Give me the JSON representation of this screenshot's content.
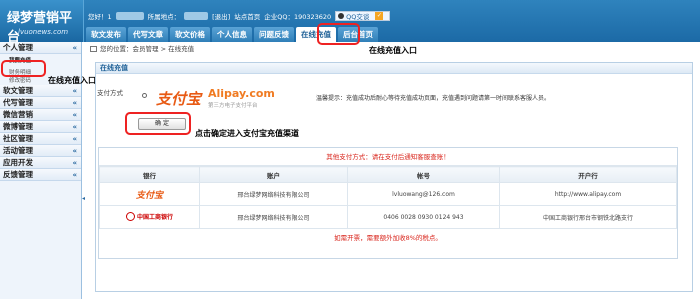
{
  "logo": {
    "title": "绿梦营销平台",
    "domain": "lvuonews.com"
  },
  "topbar": {
    "greeting": "您好！1",
    "region_label": "所属地点：",
    "logout": "[退出]",
    "site_home": "站点首页",
    "company_qq": "企业QQ：190323620",
    "qq_chat": "QQ交谈"
  },
  "nav": {
    "tabs": [
      "软文发布",
      "代写文章",
      "软文价格",
      "个人信息",
      "问题反馈",
      "在线充值",
      "后台首页"
    ],
    "active": 5
  },
  "sidebar": {
    "groups": [
      {
        "label": "个人管理",
        "subs": [
          "我要充值",
          "财务明细",
          "修改密码"
        ]
      },
      {
        "label": "软文管理",
        "subs": []
      },
      {
        "label": "代写管理",
        "subs": []
      },
      {
        "label": "微信营销",
        "subs": []
      },
      {
        "label": "微博管理",
        "subs": []
      },
      {
        "label": "社区管理",
        "subs": []
      },
      {
        "label": "活动管理",
        "subs": []
      },
      {
        "label": "应用开发",
        "subs": []
      },
      {
        "label": "反馈管理",
        "subs": []
      }
    ]
  },
  "breadcrumb": "您的位置：会员管理 > 在线充值",
  "panel": {
    "title": "在线充值",
    "pay_method_label": "支付方式",
    "alipay_cn": "支付宝",
    "alipay_en": "Alipay.com",
    "alipay_sub": "第三方电子支付平台",
    "tip": "温馨提示：充值成功后耐心等待充值成功页面，充值遇到问题请第一时间联系客服人员。",
    "confirm_label": "确 定",
    "other_title": "其他支付方式：请在支付后通知客服查账！",
    "columns": [
      "银行",
      "账户",
      "帐号",
      "开户行"
    ],
    "rows": [
      {
        "bank": "支付宝",
        "account": "邢台绿梦网络科技有限公司",
        "number": "lvluowang@126.com",
        "branch": "http://www.alipay.com"
      },
      {
        "bank": "中国工商银行",
        "account": "邢台绿梦网络科技有限公司",
        "number": "0406 0028 0930 0124 943",
        "branch": "中国工商银行邢台市钢铁北路支行"
      }
    ],
    "footnote": "如需开票，需要额外加收8%的税点。"
  },
  "annotations": {
    "nav_entry": "在线充值入口",
    "side_entry": "在线充值入口",
    "confirm_hint": "点击确定进入支付宝充值渠道"
  },
  "colors": {
    "header": "#1c6aa6",
    "highlight": "#e22222",
    "alipay": "#e85a14"
  }
}
